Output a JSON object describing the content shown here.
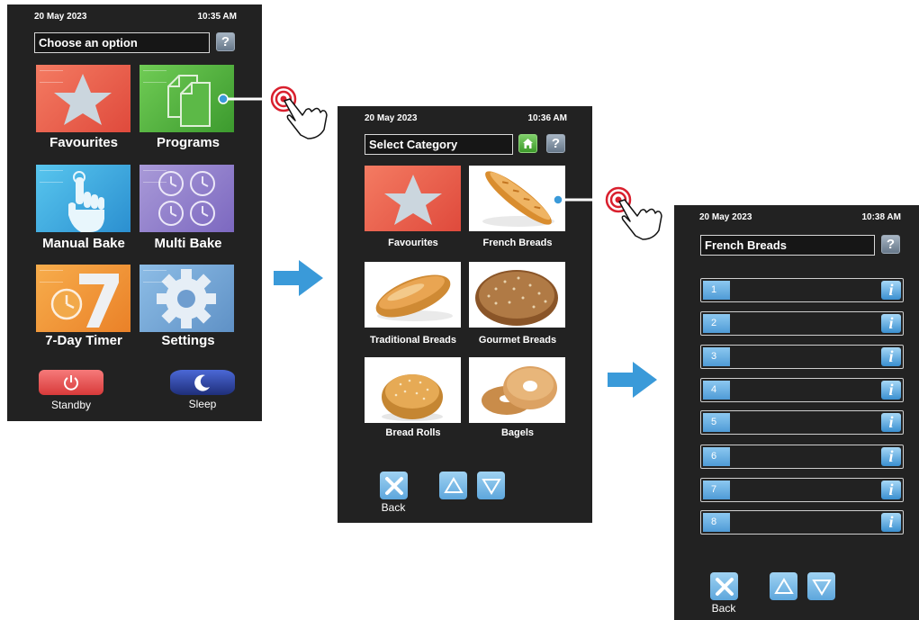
{
  "screen_main": {
    "date": "20 May 2023",
    "time": "10:35 AM",
    "title": "Choose an option",
    "help_icon": "question-mark-icon",
    "tiles": [
      {
        "label": "Favourites",
        "icon": "star-icon"
      },
      {
        "label": "Programs",
        "icon": "documents-icon"
      },
      {
        "label": "Manual Bake",
        "icon": "hand-pointer-icon"
      },
      {
        "label": "Multi Bake",
        "icon": "clocks-icon"
      },
      {
        "label": "7-Day Timer",
        "icon": "timer-seven-icon"
      },
      {
        "label": "Settings",
        "icon": "gear-icon"
      }
    ],
    "standby_label": "Standby",
    "sleep_label": "Sleep"
  },
  "screen_category": {
    "date": "20 May 2023",
    "time": "10:36 AM",
    "title": "Select Category",
    "categories": [
      {
        "label": "Favourites"
      },
      {
        "label": "French Breads"
      },
      {
        "label": "Traditional Breads"
      },
      {
        "label": "Gourmet Breads"
      },
      {
        "label": "Bread Rolls"
      },
      {
        "label": "Bagels"
      }
    ],
    "back_label": "Back"
  },
  "screen_programs": {
    "date": "20 May 2023",
    "time": "10:38 AM",
    "title": "French Breads",
    "programs": [
      {
        "number": "1"
      },
      {
        "number": "2"
      },
      {
        "number": "3"
      },
      {
        "number": "4"
      },
      {
        "number": "5"
      },
      {
        "number": "6"
      },
      {
        "number": "7"
      },
      {
        "number": "8"
      }
    ],
    "info_label": "i",
    "back_label": "Back"
  },
  "colors": {
    "screen_bg": "#222222",
    "flow_arrow": "#3a9ad9",
    "touch_ring": "#d9202e"
  }
}
